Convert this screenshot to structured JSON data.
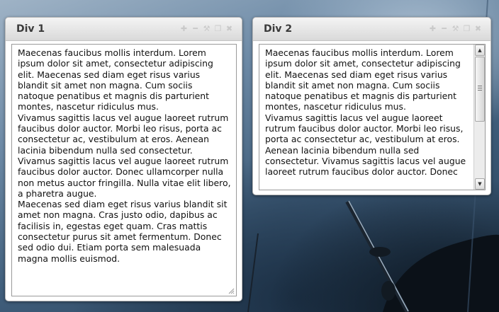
{
  "panels": [
    {
      "title": "Div 1",
      "paragraphs": [
        "Maecenas faucibus mollis interdum. Lorem ipsum dolor sit amet, consectetur adipiscing elit. Maecenas sed diam eget risus varius blandit sit amet non magna. Cum sociis natoque penatibus et magnis dis parturient montes, nascetur ridiculus mus.",
        "Vivamus sagittis lacus vel augue laoreet rutrum faucibus dolor auctor. Morbi leo risus, porta ac consectetur ac, vestibulum at eros. Aenean lacinia bibendum nulla sed consectetur. Vivamus sagittis lacus vel augue laoreet rutrum faucibus dolor auctor. Donec ullamcorper nulla non metus auctor fringilla. Nulla vitae elit libero, a pharetra augue.",
        "Maecenas sed diam eget risus varius blandit sit amet non magna. Cras justo odio, dapibus ac facilisis in, egestas eget quam. Cras mattis consectetur purus sit amet fermentum. Donec sed odio dui. Etiam porta sem malesuada magna mollis euismod."
      ]
    },
    {
      "title": "Div 2",
      "paragraphs": [
        "Maecenas faucibus mollis interdum. Lorem ipsum dolor sit amet, consectetur adipiscing elit. Maecenas sed diam eget risus varius blandit sit amet non magna. Cum sociis natoque penatibus et magnis dis parturient montes, nascetur ridiculus mus.",
        "Vivamus sagittis lacus vel augue laoreet rutrum faucibus dolor auctor. Morbi leo risus, porta ac consectetur ac, vestibulum at eros. Aenean lacinia bibendum nulla sed consectetur. Vivamus sagittis lacus vel augue laoreet rutrum faucibus dolor auctor. Donec"
      ]
    }
  ],
  "controls": [
    "plus-icon",
    "minus-icon",
    "wrench-icon",
    "restore-icon",
    "close-icon"
  ],
  "colors": {
    "title_text": "#3a3a3a",
    "control_icon": "#c9c9c9",
    "panel_border": "#b9b9b9"
  }
}
